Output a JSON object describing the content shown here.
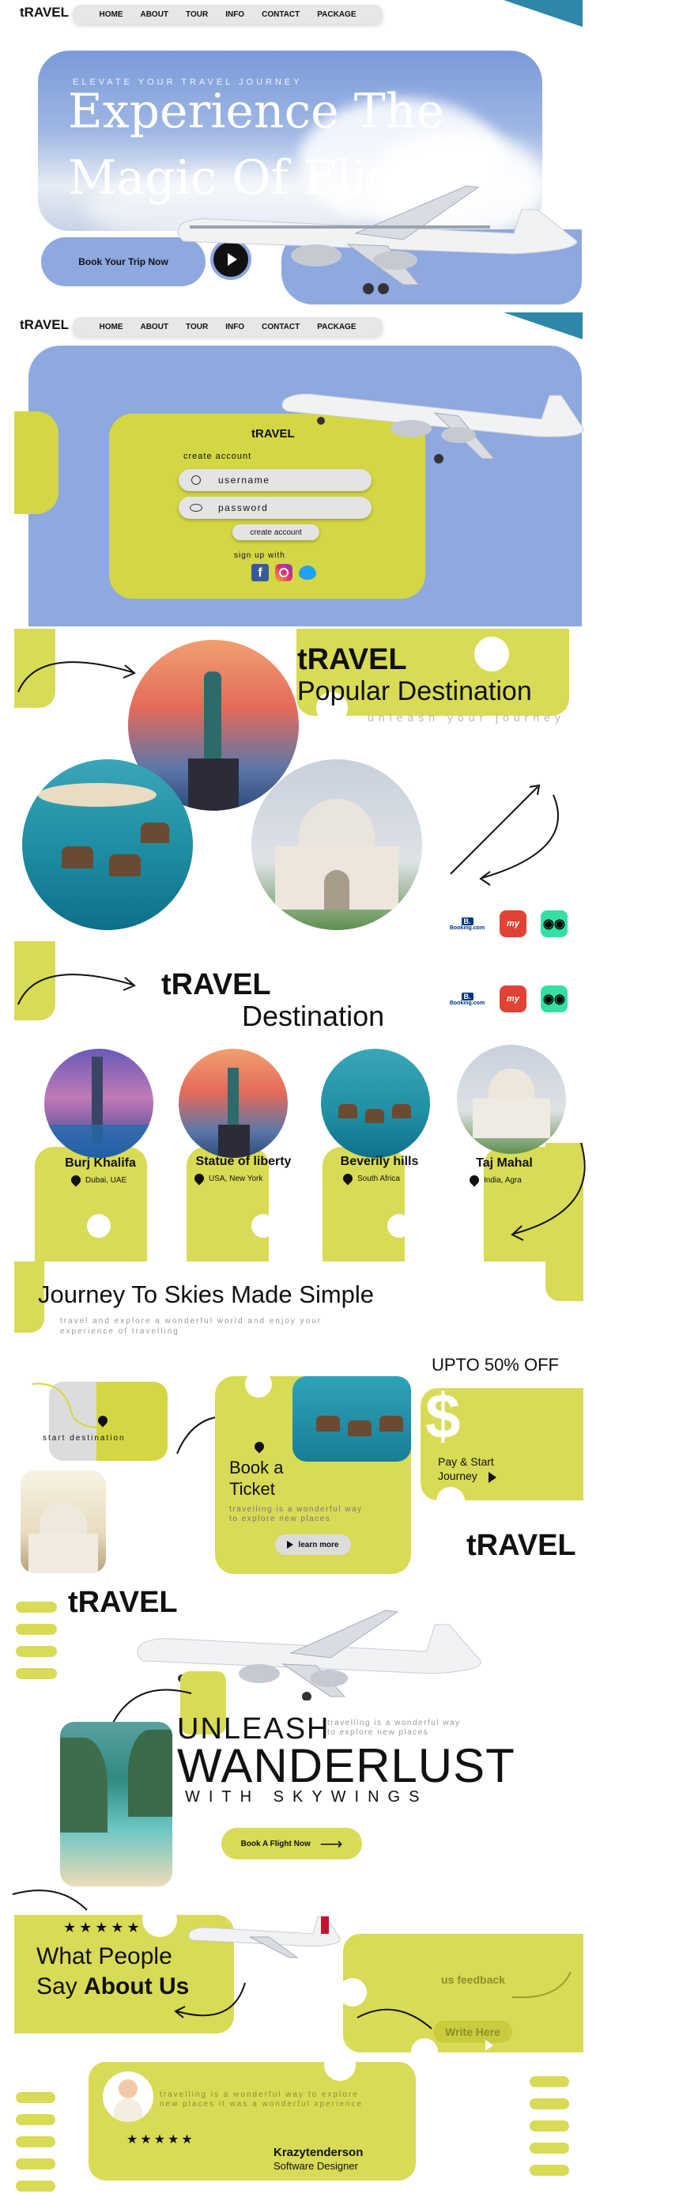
{
  "brand": "tRAVEL",
  "nav": [
    "HOME",
    "ABOUT",
    "TOUR",
    "INFO",
    "CONTACT",
    "PACKAGE"
  ],
  "hero": {
    "kicker": "ELEVATE YOUR TRAVEL JOURNEY",
    "title_line1": "Experience The",
    "title_line2": "Magic Of Flight",
    "cta": "Book Your Trip Now"
  },
  "login": {
    "brand": "tRAVEL",
    "create_label": "create account",
    "username_placeholder": "username",
    "password_placeholder": "password",
    "create_button": "create account",
    "signup": "sign up with"
  },
  "popular": {
    "brand": "tRAVEL",
    "title": "Popular Destination",
    "subtitle": "unleash your journey"
  },
  "partners": [
    "Booking.com",
    "my",
    "tripadvisor"
  ],
  "destination": {
    "brand": "tRAVEL",
    "title": "Destination",
    "cards": [
      {
        "name": "Burj Khalifa",
        "location": "Dubai, UAE"
      },
      {
        "name": "Statue of liberty",
        "location": "USA, New York"
      },
      {
        "name": "Beverily hills",
        "location": "South Africa"
      },
      {
        "name": "Taj Mahal",
        "location": "India, Agra"
      }
    ]
  },
  "journey": {
    "title": "Journey To Skies Made Simple",
    "subtitle_line1": "travel and explore a wonderful world and enjoy your",
    "subtitle_line2": "experience of travelling",
    "start_destination": "start destination",
    "book_line1": "Book a",
    "book_line2": "Ticket",
    "book_desc_line1": "travelling is a wonderful way",
    "book_desc_line2": "to explore new places",
    "learn_more": "learn more",
    "offer": "UPTO 50% OFF",
    "pay_line1": "Pay & Start",
    "pay_line2": "Journey",
    "brand": "tRAVEL"
  },
  "wander": {
    "brand": "tRAVEL",
    "unleash": "UNLEASH",
    "small_line1": "travelling is a wonderful way",
    "small_line2": "to explore new places",
    "wanderlust": "WANDERLUST",
    "with": "WITH SKYWINGS",
    "cta": "Book A Flight Now"
  },
  "testimonials": {
    "title_line1": "What People",
    "title_line2_plain": "Say",
    "title_line2_bold": "About Us",
    "feedback": "us feedback",
    "write": "Write Here",
    "quote_line1": "travelling is a wonderful way to explore",
    "quote_line2": "new places it was a wonderful xperience",
    "author": "Krazytenderson",
    "role": "Software Designer",
    "stars_top": "★★★★★",
    "stars_card": "★★★★★"
  },
  "colors": {
    "lime": "#d3d743",
    "blue": "#8ea8e0",
    "teal": "#2f86a8"
  }
}
